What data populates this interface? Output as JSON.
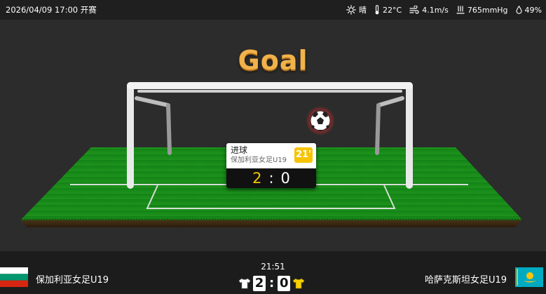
{
  "header": {
    "datetime": "2026/04/09 17:00 开赛",
    "weather": {
      "condition": "晴",
      "temperature": "22°C",
      "wind": "4.1m/s",
      "pressure": "765mmHg",
      "humidity": "49%"
    },
    "icons": [
      "sun-icon",
      "thermometer-icon",
      "wind-icon",
      "pressure-icon",
      "droplet-icon"
    ]
  },
  "animation": {
    "title": "Goal",
    "event_card": {
      "event": "进球",
      "team": "保加利亚女足U19",
      "minute": "21'",
      "home_score": "2",
      "separator": ":",
      "away_score": "0"
    }
  },
  "match": {
    "clock": "21:51",
    "home": {
      "name": "保加利亚女足U19",
      "score": "2",
      "flag": "bulgaria-flag",
      "shirt_color": "#ffffff"
    },
    "away": {
      "name": "哈萨克斯坦女足U19",
      "score": "0",
      "flag": "kazakhstan-flag",
      "shirt_color": "#f7d000"
    },
    "separator": ":"
  },
  "colors": {
    "goal_title": "#f1b24a",
    "pitch": "#1f8a1f",
    "minute_badge": "#f7c300",
    "home_score_highlight": "#f7c300"
  }
}
